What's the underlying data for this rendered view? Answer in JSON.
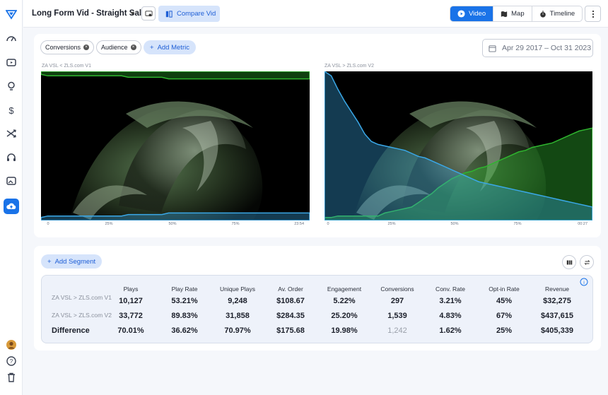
{
  "header": {
    "title": "Long Form Vid - Straight Sale",
    "compare_label": "Compare Vid",
    "views": [
      {
        "label": "Video",
        "icon": "play-icon",
        "active": true
      },
      {
        "label": "Map",
        "icon": "map-icon",
        "active": false
      },
      {
        "label": "Timeline",
        "icon": "stopwatch-icon",
        "active": false
      }
    ]
  },
  "sidebar": {
    "icons": [
      "logo-icon",
      "dashboard-icon",
      "video-icon",
      "bulb-icon",
      "dollar-icon",
      "shuffle-icon",
      "headset-icon",
      "image-icon",
      "upload-cloud-icon",
      "avatar",
      "help-icon",
      "trash-icon"
    ],
    "active": "upload-cloud-icon"
  },
  "metrics": {
    "pills": [
      "Conversions",
      "Audience"
    ],
    "add_metric": "Add Metric",
    "date_range": "Apr 29 2017 – Oct 31 2023"
  },
  "videos": [
    {
      "label": "ZA VSL < ZLS.com V1",
      "ticks": [
        "0",
        "25%",
        "50%",
        "75%",
        "23:54"
      ],
      "retention_pct": [
        100,
        97,
        90,
        79,
        72,
        68,
        66,
        64,
        62,
        59,
        56,
        53,
        50,
        47,
        44,
        41,
        38,
        35,
        33,
        31,
        29,
        27,
        25,
        23,
        22,
        21,
        20,
        19,
        18,
        17,
        16,
        15,
        14,
        13,
        12,
        11,
        10,
        9,
        8,
        7,
        6
      ],
      "conversions_pct": [
        2,
        3,
        3,
        3,
        3,
        3,
        3,
        3,
        3,
        3,
        3,
        3,
        3,
        4,
        4,
        4,
        4,
        4,
        4,
        5,
        5,
        5,
        5,
        5,
        5,
        5,
        5,
        5,
        5,
        5,
        5,
        5,
        5,
        5,
        5,
        5,
        5,
        5,
        5,
        5,
        5
      ]
    },
    {
      "label": "ZA VSL > ZLS.com V2",
      "ticks": [
        "0",
        "25%",
        "50%",
        "75%",
        "00:27"
      ],
      "retention_pct": [
        100,
        97,
        88,
        80,
        73,
        66,
        58,
        53,
        51,
        50,
        49,
        48,
        47,
        45,
        43,
        42,
        40,
        38,
        36,
        34,
        32,
        30,
        28,
        26,
        25,
        24,
        23,
        22,
        21,
        20,
        19,
        18,
        17,
        16,
        15,
        14,
        13,
        12,
        11,
        10,
        9
      ],
      "conversions_pct": [
        2,
        2,
        3,
        3,
        3,
        3,
        3,
        3,
        3,
        5,
        6,
        7,
        8,
        9,
        12,
        15,
        18,
        22,
        25,
        28,
        30,
        32,
        33,
        35,
        36,
        38,
        40,
        42,
        44,
        46,
        47,
        49,
        50,
        51,
        52,
        54,
        56,
        58,
        60,
        61,
        62
      ]
    }
  ],
  "segments": {
    "add_segment": "Add Segment"
  },
  "table": {
    "headers": [
      "Plays",
      "Play Rate",
      "Unique Plays",
      "Av. Order",
      "Engagement",
      "Conversions",
      "Conv. Rate",
      "Opt-in Rate",
      "Revenue"
    ],
    "rows": [
      {
        "label": "ZA VSL > ZLS.com V1",
        "values": [
          "10,127",
          "53.21%",
          "9,248",
          "$108.67",
          "5.22%",
          "297",
          "3.21%",
          "45%",
          "$32,275"
        ]
      },
      {
        "label": "ZA VSL > ZLS.com V2",
        "values": [
          "33,772",
          "89.83%",
          "31,858",
          "$284.35",
          "25.20%",
          "1,539",
          "4.83%",
          "67%",
          "$437,615"
        ]
      },
      {
        "label": "Difference",
        "values": [
          "70.01%",
          "36.62%",
          "70.97%",
          "$175.68",
          "19.98%",
          "1,242",
          "1.62%",
          "25%",
          "$405,339"
        ]
      }
    ]
  },
  "colors": {
    "accent": "#1a73e8",
    "retention": "#3aa8e8",
    "conversions": "#2fb52f"
  }
}
